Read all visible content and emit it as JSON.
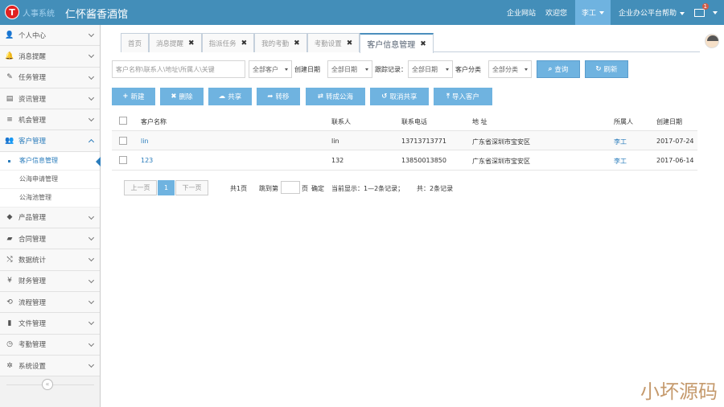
{
  "header": {
    "logo_letter": "T",
    "brand_sub": "人事系统",
    "title": "仁怀酱香酒馆",
    "links": [
      "企业网站",
      "欢迎您"
    ],
    "user": "李工",
    "help": "企业办公平台帮助",
    "mail_count": "1"
  },
  "sidebar": {
    "items": [
      {
        "label": "个人中心",
        "icon": "user-icon",
        "glyph": "👤"
      },
      {
        "label": "消息提醒",
        "icon": "bell-icon",
        "glyph": "🔔"
      },
      {
        "label": "任务管理",
        "icon": "edit-icon",
        "glyph": "✎"
      },
      {
        "label": "资讯管理",
        "icon": "document-icon",
        "glyph": "▤"
      },
      {
        "label": "机会管理",
        "icon": "list-icon",
        "glyph": "≡"
      },
      {
        "label": "客户管理",
        "icon": "users-icon",
        "glyph": "👥"
      },
      {
        "label": "产品管理",
        "icon": "dropbox-icon",
        "glyph": "◆"
      },
      {
        "label": "合同管理",
        "icon": "folder-icon",
        "glyph": "▰"
      },
      {
        "label": "数据统计",
        "icon": "shuffle-icon",
        "glyph": "⤭"
      },
      {
        "label": "财务管理",
        "icon": "yen-icon",
        "glyph": "¥"
      },
      {
        "label": "流程管理",
        "icon": "retweet-icon",
        "glyph": "⟲"
      },
      {
        "label": "文件管理",
        "icon": "file-icon",
        "glyph": "▮"
      },
      {
        "label": "考勤管理",
        "icon": "clock-icon",
        "glyph": "◷"
      },
      {
        "label": "系统设置",
        "icon": "cog-icon",
        "glyph": "✲"
      }
    ],
    "sub_items": [
      "客户信息管理",
      "公海申请管理",
      "公海池管理"
    ],
    "collapse": "«"
  },
  "tabs": [
    {
      "label": "首页",
      "closable": false
    },
    {
      "label": "消息提醒",
      "closable": true
    },
    {
      "label": "指派任务",
      "closable": true
    },
    {
      "label": "我的考勤",
      "closable": true
    },
    {
      "label": "考勤设置",
      "closable": true
    },
    {
      "label": "客户信息管理",
      "closable": true,
      "active": true
    }
  ],
  "filters": {
    "search_placeholder": "客户名称\\联系人\\地址\\所属人\\关键",
    "customer_select": "全部客户",
    "created_label": "创建日期",
    "created_select": "全部日期",
    "followup_label": "跟踪记录：",
    "followup_select": "全部日期",
    "category_label": "客户分类",
    "category_select": "全部分类",
    "query_btn": "查询",
    "refresh_btn": "刷新"
  },
  "actions": [
    "新建",
    "删除",
    "共享",
    "转移",
    "转成公海",
    "取消共享",
    "导入客户"
  ],
  "table": {
    "headers": [
      "客户名称",
      "联系人",
      "联系电话",
      "地 址",
      "所属人",
      "创建日期"
    ],
    "rows": [
      [
        "lin",
        "lin",
        "13713713771",
        "广东省深圳市宝安区",
        "李工",
        "2017-07-24"
      ],
      [
        "123",
        "132",
        "13850013850",
        "广东省深圳市宝安区",
        "李工",
        "2017-06-14"
      ]
    ]
  },
  "pagination": {
    "prev": "上一页",
    "current": "1",
    "next": "下一页",
    "total_pages": "共1页",
    "jump_label": "跳到第",
    "page_suffix": "页",
    "confirm": "确定",
    "display": "当前显示：1—2条记录；",
    "total": "共：2条记录"
  },
  "watermark": "小坏源码"
}
